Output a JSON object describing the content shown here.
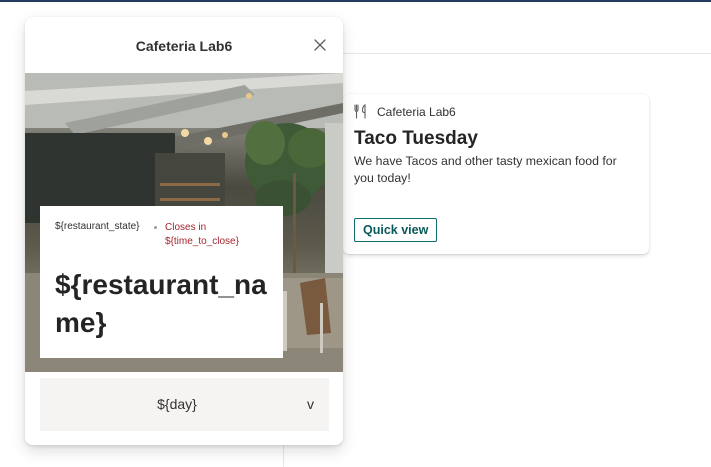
{
  "card": {
    "app_icon": "fork-knife-icon",
    "app_name": "Cafeteria Lab6",
    "title": "Taco Tuesday",
    "description": "We have Tacos and other tasty mexican food for you today!",
    "button_label": "Quick view"
  },
  "panel": {
    "title": "Cafeteria Lab6",
    "close_icon": "close-icon",
    "hero_image": "cafeteria-interior-photo",
    "restaurant_state": "${restaurant_state}",
    "closes_text": "Closes in ${time_to_close}",
    "restaurant_name": "${restaurant_name}",
    "day": "${day}",
    "day_chevron": "v"
  },
  "colors": {
    "accent": "#0f6c6c",
    "closing_text": "#a4262c",
    "day_bar_bg": "#f5f4f3",
    "top_rule": "#243a5e"
  }
}
